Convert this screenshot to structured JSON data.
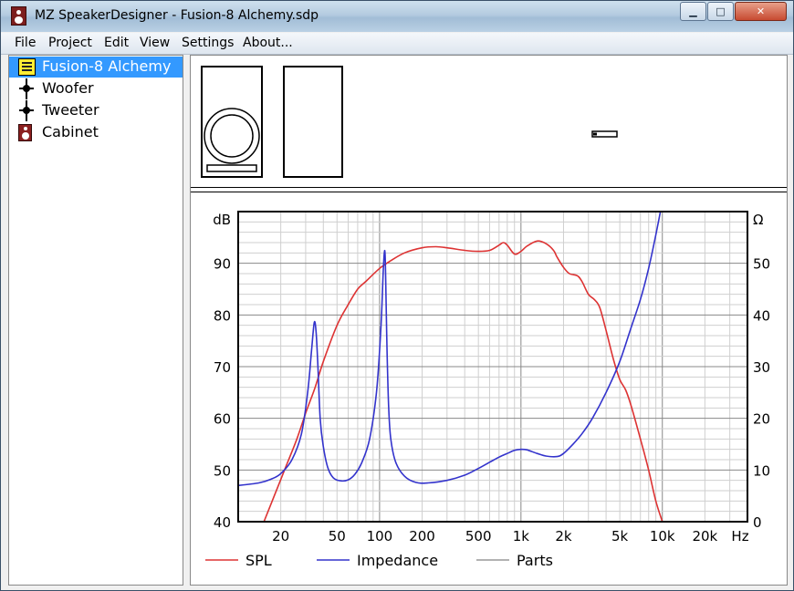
{
  "window": {
    "title": "MZ SpeakerDesigner - Fusion-8 Alchemy.sdp",
    "minimize_label": "▁",
    "maximize_label": "□",
    "close_label": "✕"
  },
  "menu": [
    "File",
    "Project",
    "Edit",
    "View",
    "Settings",
    "About..."
  ],
  "tree": [
    {
      "label": "Fusion-8 Alchemy",
      "icon": "project-icon",
      "selected": true
    },
    {
      "label": "Woofer",
      "icon": "driver-icon",
      "selected": false
    },
    {
      "label": "Tweeter",
      "icon": "driver-icon",
      "selected": false
    },
    {
      "label": "Cabinet",
      "icon": "cabinet-icon",
      "selected": false
    }
  ],
  "chart_data": {
    "type": "line",
    "x_scale": "log",
    "xlim": [
      10,
      40000
    ],
    "x_ticks": [
      {
        "v": 20,
        "label": "20"
      },
      {
        "v": 50,
        "label": "50"
      },
      {
        "v": 100,
        "label": "100"
      },
      {
        "v": 200,
        "label": "200"
      },
      {
        "v": 500,
        "label": "500"
      },
      {
        "v": 1000,
        "label": "1k"
      },
      {
        "v": 2000,
        "label": "2k"
      },
      {
        "v": 5000,
        "label": "5k"
      },
      {
        "v": 10000,
        "label": "10k"
      },
      {
        "v": 20000,
        "label": "20k"
      }
    ],
    "x_unit": "Hz",
    "left_axis": {
      "unit": "dB",
      "ylim": [
        40,
        100
      ],
      "ticks": [
        40,
        50,
        60,
        70,
        80,
        90
      ]
    },
    "right_axis": {
      "unit": "Ω",
      "ylim": [
        0,
        60
      ],
      "ticks": [
        0,
        10,
        20,
        30,
        40,
        50
      ]
    },
    "grid": true,
    "legend_position": "bottom",
    "series": [
      {
        "name": "SPL",
        "axis": "left",
        "color": "#dd3333",
        "x": [
          15.2,
          18,
          22,
          26,
          30,
          35,
          40,
          50,
          60,
          70,
          80,
          100,
          120,
          150,
          200,
          250,
          300,
          400,
          500,
          600,
          700,
          750,
          800,
          900,
          1000,
          1100,
          1300,
          1500,
          1700,
          1800,
          2000,
          2200,
          2500,
          2700,
          3000,
          3300,
          3600,
          4000,
          4500,
          5000,
          5500,
          6000,
          7000,
          8000,
          9000,
          10000
        ],
        "y": [
          40,
          45,
          51,
          56,
          61,
          66,
          71,
          78,
          82,
          85,
          86.5,
          89,
          90.5,
          92,
          93,
          93.2,
          93,
          92.5,
          92.3,
          92.5,
          93.5,
          94,
          93.5,
          91.8,
          92.3,
          93.3,
          94.3,
          93.8,
          92.5,
          91.2,
          89.2,
          88,
          87.6,
          86.5,
          84,
          83,
          81.5,
          77,
          71.5,
          67.5,
          65.5,
          62.5,
          56,
          50,
          44,
          40
        ]
      },
      {
        "name": "Impedance",
        "axis": "right",
        "color": "#3333cc",
        "x": [
          10,
          14,
          17,
          20,
          24,
          28,
          31,
          33,
          34.5,
          35.5,
          36.5,
          38,
          40,
          43,
          47,
          53,
          60,
          67,
          75,
          85,
          95,
          102,
          106,
          108,
          109.5,
          111,
          113,
          116,
          120,
          130,
          150,
          180,
          220,
          300,
          400,
          500,
          600,
          700,
          800,
          900,
          1000,
          1100,
          1300,
          1500,
          1800,
          2000,
          2300,
          2700,
          3200,
          4000,
          5000,
          6000,
          7000,
          8000,
          9000,
          10000
        ],
        "y": [
          7,
          7.5,
          8.2,
          9.3,
          12,
          17,
          25,
          33,
          38.5,
          37,
          31,
          20,
          14.5,
          10.5,
          8.5,
          7.9,
          8.1,
          9.2,
          11.5,
          16,
          25,
          37,
          48,
          52,
          51.5,
          44,
          33,
          22,
          16,
          11.5,
          8.8,
          7.6,
          7.5,
          8,
          9,
          10.3,
          11.5,
          12.5,
          13.2,
          13.8,
          14,
          13.9,
          13.2,
          12.7,
          12.6,
          13.2,
          14.8,
          17,
          20,
          25,
          31,
          37.5,
          43,
          49,
          55.5,
          62
        ]
      },
      {
        "name": "Parts",
        "axis": "left",
        "color": "#999999",
        "x": [],
        "y": []
      }
    ]
  }
}
